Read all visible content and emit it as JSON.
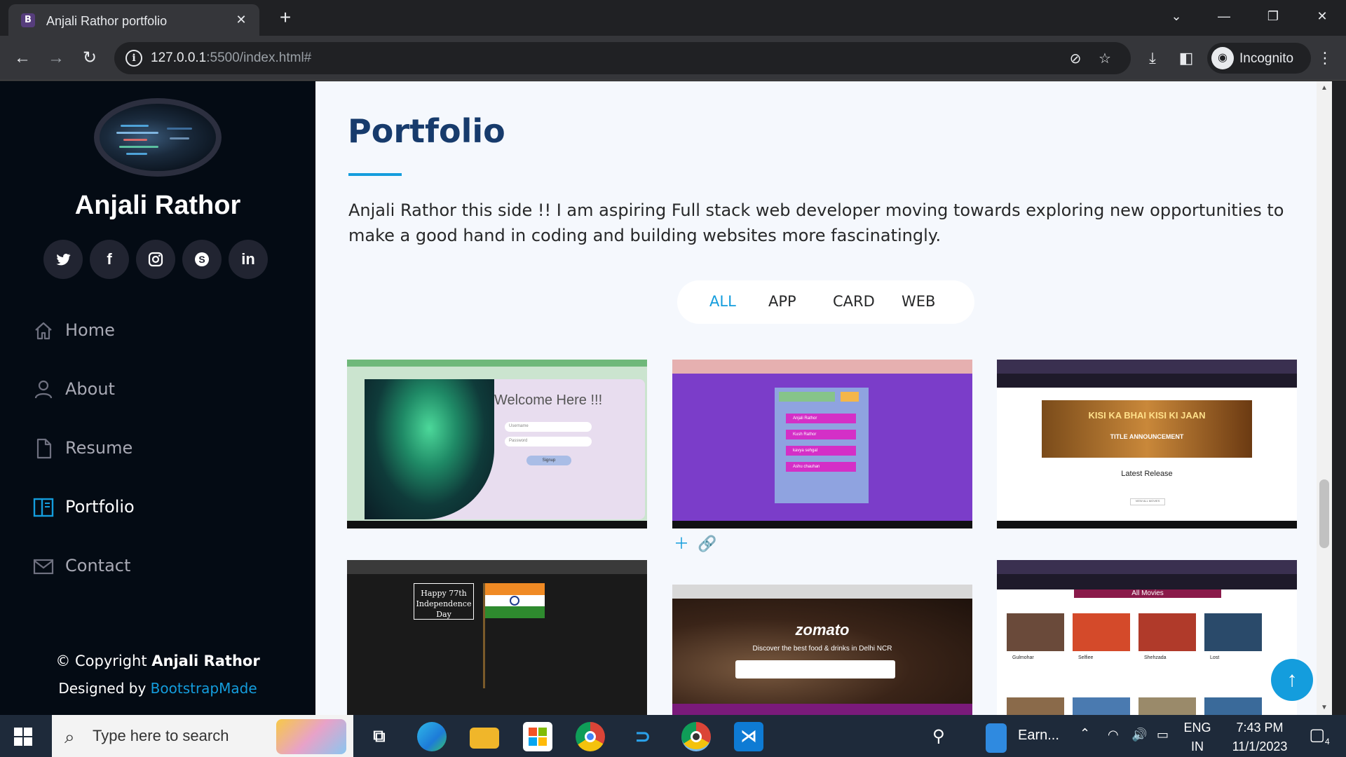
{
  "browser": {
    "tab_title": "Anjali Rathor portfolio",
    "tab_favicon": "B",
    "url_host": "127.0.0.1",
    "url_rest": ":5500/index.html#",
    "profile_label": "Incognito"
  },
  "sidebar": {
    "name": "Anjali Rathor",
    "social": [
      "twitter-icon",
      "facebook-icon",
      "instagram-icon",
      "skype-icon",
      "linkedin-icon"
    ],
    "nav": [
      {
        "label": "Home",
        "icon": "home-icon"
      },
      {
        "label": "About",
        "icon": "person-icon"
      },
      {
        "label": "Resume",
        "icon": "file-icon"
      },
      {
        "label": "Portfolio",
        "icon": "book-icon",
        "active": true
      },
      {
        "label": "Contact",
        "icon": "envelope-icon"
      }
    ],
    "copyright_prefix": "© Copyright ",
    "copyright_name": "Anjali Rathor",
    "designed_prefix": "Designed by ",
    "designed_link": "BootstrapMade"
  },
  "portfolio": {
    "heading": "Portfolio",
    "intro": "Anjali Rathor this side !! I am aspiring Full stack web developer moving towards exploring new opportunities to make a good hand in coding and building websites more fascinatingly.",
    "filters": [
      "ALL",
      "APP",
      "CARD",
      "WEB"
    ],
    "active_filter": "ALL",
    "cards": [
      {
        "welcome": "Welcome Here !!!",
        "field1": "Username",
        "field2": "Password",
        "button": "Signup"
      },
      {
        "items": [
          "Anjali Rathor",
          "Kush Rathor",
          "kavya sehgal",
          "Ashu chauhan"
        ]
      },
      {
        "banner": "KISI KA BHAI KISI KI JAAN",
        "sub": "TITLE ANNOUNCEMENT",
        "caption": "Latest Release",
        "btn": "VIEW ALL MOVIES"
      },
      {
        "text": "Happy 77th Independence Day"
      },
      {
        "logo": "zomato",
        "tagline": "Discover the best food & drinks in Delhi NCR"
      },
      {
        "header": "All Movies",
        "movies": [
          "Gulmohar",
          "Selfiee",
          "Shehzada",
          "Lost"
        ]
      }
    ]
  },
  "taskbar": {
    "search_placeholder": "Type here to search",
    "pinned_label": "Earn...",
    "lang_top": "ENG",
    "lang_bottom": "IN",
    "time": "7:43 PM",
    "date": "11/1/2023",
    "notifications": "4"
  },
  "colors": {
    "accent": "#149ddd",
    "sidebar_bg": "#040b14",
    "heading": "#173b6c"
  }
}
